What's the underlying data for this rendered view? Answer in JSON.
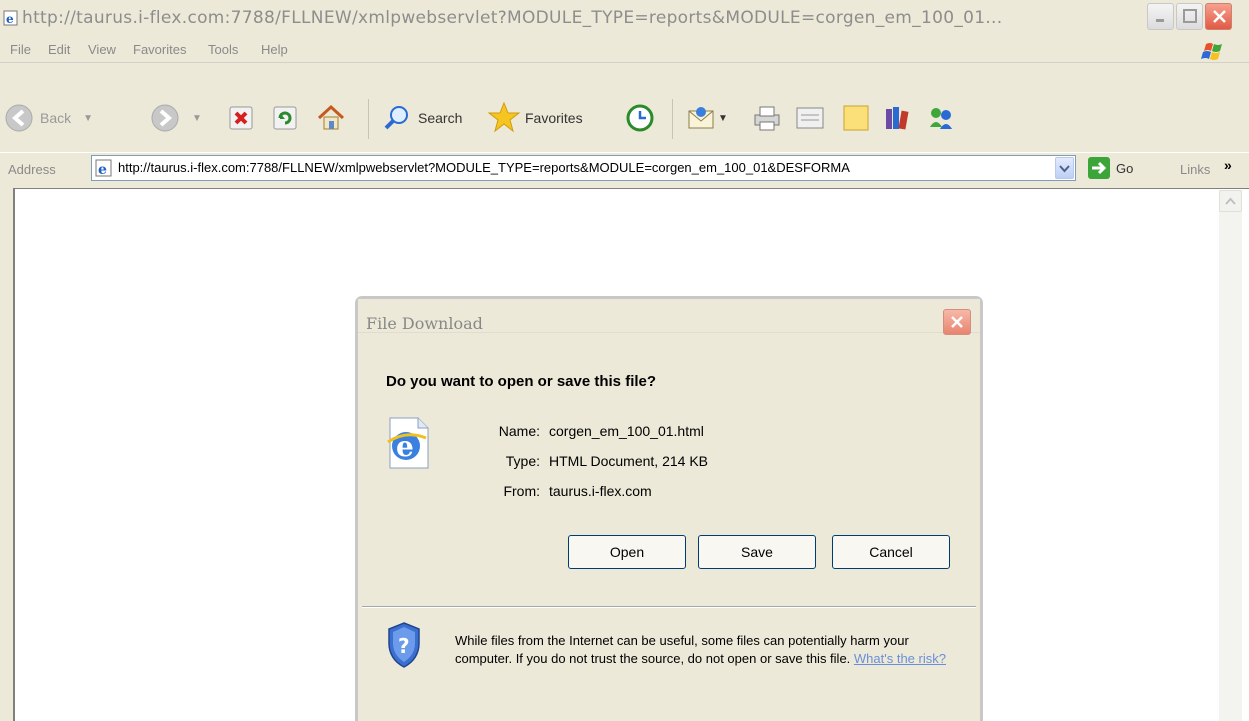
{
  "browser": {
    "title": "http://taurus.i-flex.com:7788/FLLNEW/xmlpwebservlet?MODULE_TYPE=reports&MODULE=corgen_em_100_01...",
    "menu": [
      "File",
      "Edit",
      "View",
      "Favorites",
      "Tools",
      "Help"
    ],
    "toolbar": {
      "back_label": "Back",
      "search_label": "Search",
      "favorites_label": "Favorites"
    },
    "address": {
      "label": "Address",
      "value": "http://taurus.i-flex.com:7788/FLLNEW/xmlpwebservlet?MODULE_TYPE=reports&MODULE=corgen_em_100_01&DESFORMA",
      "go_label": "Go",
      "links_label": "Links",
      "links_chevron": "»"
    }
  },
  "dialog": {
    "title": "File Download",
    "question": "Do you want to open or save this file?",
    "name_label": "Name:",
    "name_value": "corgen_em_100_01.html",
    "type_label": "Type:",
    "type_value": "HTML Document, 214 KB",
    "from_label": "From:",
    "from_value": "taurus.i-flex.com",
    "buttons": {
      "open": "Open",
      "save": "Save",
      "cancel": "Cancel"
    },
    "warning_text": "While files from the Internet can be useful, some files can potentially harm your computer. If you do not trust the source, do not open or save this file.",
    "risk_link": "What's the risk?"
  }
}
